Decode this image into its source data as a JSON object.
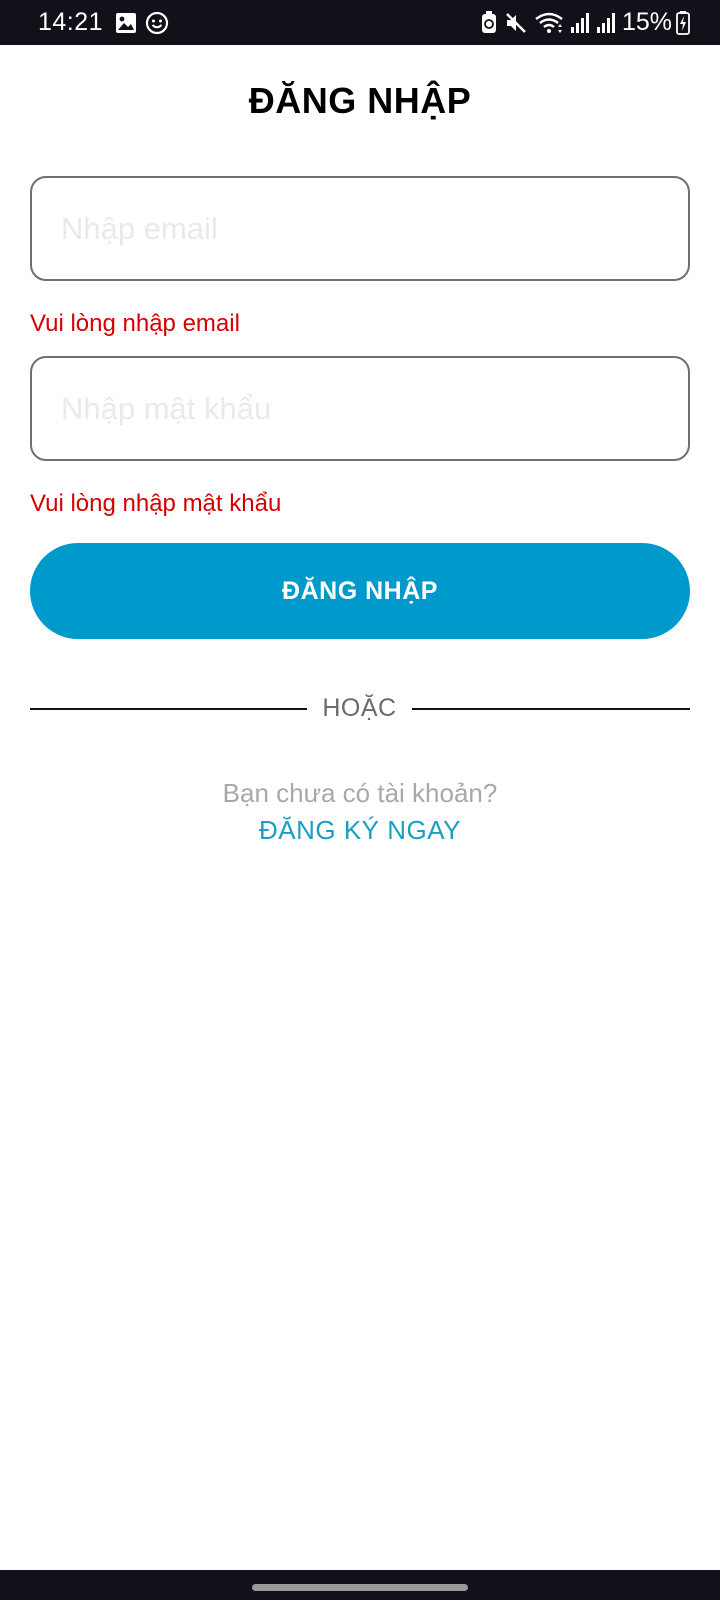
{
  "status_bar": {
    "time": "14:21",
    "left_icons": [
      "image-icon",
      "smiley-icon"
    ],
    "right_icons": [
      "nfc-icon",
      "mute-icon",
      "wifi-icon",
      "signal-icon",
      "signal-icon"
    ],
    "battery_percent": "15%"
  },
  "page": {
    "title": "ĐĂNG NHẬP"
  },
  "form": {
    "email": {
      "value": "",
      "placeholder": "Nhập email",
      "error": "Vui lòng nhập email"
    },
    "password": {
      "value": "",
      "placeholder": "Nhập mật khẩu",
      "error": "Vui lòng nhập mật khẩu"
    },
    "login_label": "ĐĂNG NHẬP"
  },
  "divider": {
    "label": "HOẶC"
  },
  "register": {
    "prompt": "Bạn chưa có tài khoản?",
    "link_label": "ĐĂNG KÝ NGAY"
  },
  "colors": {
    "primary": "#0099cc",
    "error": "#d40000",
    "link": "#1a9fc4",
    "status_bar": "#121018"
  }
}
